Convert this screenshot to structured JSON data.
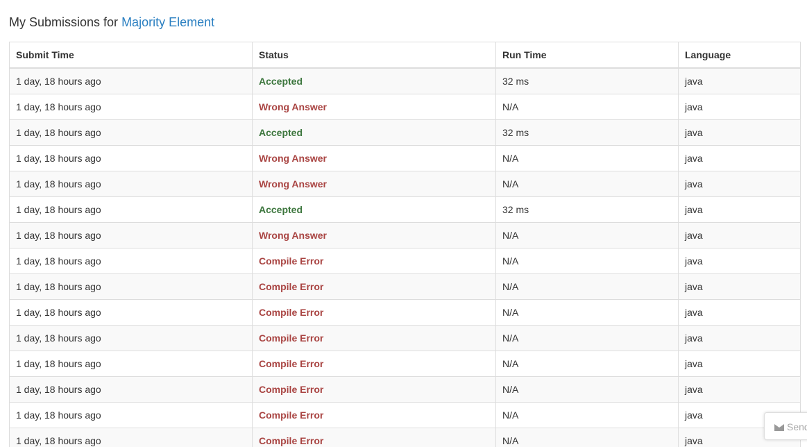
{
  "heading": {
    "prefix": "My Submissions for",
    "problem_link": "Majority Element"
  },
  "table": {
    "columns": [
      "Submit Time",
      "Status",
      "Run Time",
      "Language"
    ],
    "rows": [
      {
        "time": "1 day, 18 hours ago",
        "status": "Accepted",
        "status_type": "ok",
        "runtime": "32 ms",
        "language": "java"
      },
      {
        "time": "1 day, 18 hours ago",
        "status": "Wrong Answer",
        "status_type": "bad",
        "runtime": "N/A",
        "language": "java"
      },
      {
        "time": "1 day, 18 hours ago",
        "status": "Accepted",
        "status_type": "ok",
        "runtime": "32 ms",
        "language": "java"
      },
      {
        "time": "1 day, 18 hours ago",
        "status": "Wrong Answer",
        "status_type": "bad",
        "runtime": "N/A",
        "language": "java"
      },
      {
        "time": "1 day, 18 hours ago",
        "status": "Wrong Answer",
        "status_type": "bad",
        "runtime": "N/A",
        "language": "java"
      },
      {
        "time": "1 day, 18 hours ago",
        "status": "Accepted",
        "status_type": "ok",
        "runtime": "32 ms",
        "language": "java"
      },
      {
        "time": "1 day, 18 hours ago",
        "status": "Wrong Answer",
        "status_type": "bad",
        "runtime": "N/A",
        "language": "java"
      },
      {
        "time": "1 day, 18 hours ago",
        "status": "Compile Error",
        "status_type": "bad",
        "runtime": "N/A",
        "language": "java"
      },
      {
        "time": "1 day, 18 hours ago",
        "status": "Compile Error",
        "status_type": "bad",
        "runtime": "N/A",
        "language": "java"
      },
      {
        "time": "1 day, 18 hours ago",
        "status": "Compile Error",
        "status_type": "bad",
        "runtime": "N/A",
        "language": "java"
      },
      {
        "time": "1 day, 18 hours ago",
        "status": "Compile Error",
        "status_type": "bad",
        "runtime": "N/A",
        "language": "java"
      },
      {
        "time": "1 day, 18 hours ago",
        "status": "Compile Error",
        "status_type": "bad",
        "runtime": "N/A",
        "language": "java"
      },
      {
        "time": "1 day, 18 hours ago",
        "status": "Compile Error",
        "status_type": "bad",
        "runtime": "N/A",
        "language": "java"
      },
      {
        "time": "1 day, 18 hours ago",
        "status": "Compile Error",
        "status_type": "bad",
        "runtime": "N/A",
        "language": "java"
      },
      {
        "time": "1 day, 18 hours ago",
        "status": "Compile Error",
        "status_type": "bad",
        "runtime": "N/A",
        "language": "java"
      }
    ]
  },
  "feedback": {
    "icon": "envelope-icon",
    "label": "Send"
  },
  "colors": {
    "link": "#2a7fc1",
    "accepted": "#3c763d",
    "error": "#a94442"
  }
}
